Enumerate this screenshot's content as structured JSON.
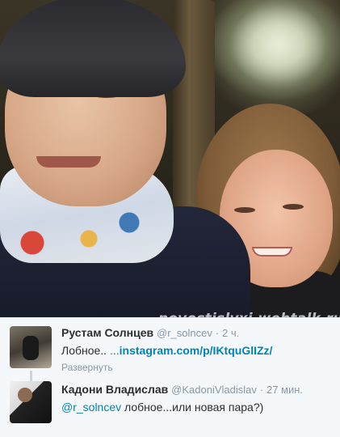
{
  "watermark": "novostislyxi.webtalk.ru",
  "tweets": [
    {
      "name": "Рустам Солнцев",
      "handle": "@r_solncev",
      "separator": "·",
      "time": "2 ч.",
      "text": "Лобное.. ",
      "link_prefix": "...",
      "link": "instagram.com/p/IKtquGlIZz/",
      "expand_label": "Развернуть",
      "avatar_icon": "user-avatar-photo"
    },
    {
      "name": "Кадони Владислав",
      "handle": "@KadoniVladislav",
      "separator": "·",
      "time": "27 мин.",
      "mention": "@r_solncev",
      "text": " лобное...или новая пара?)",
      "avatar_icon": "user-avatar-photo"
    }
  ],
  "colors": {
    "link": "#0084b4",
    "muted": "#8899a6",
    "text": "#292f33",
    "background": "#f5f8fa"
  }
}
